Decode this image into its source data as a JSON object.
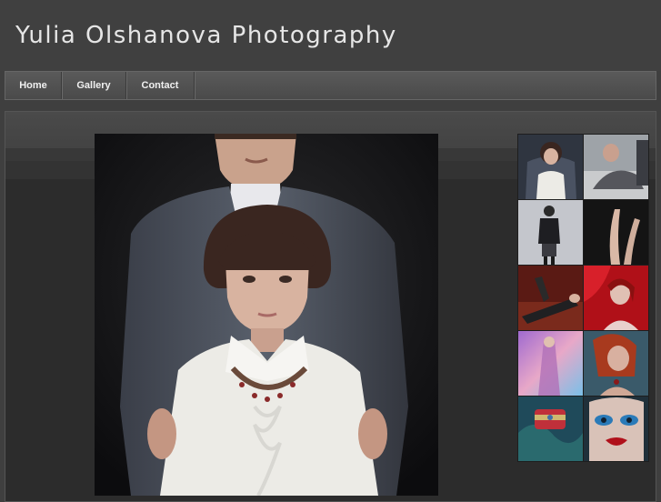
{
  "site": {
    "title": "Yulia Olshanova Photography"
  },
  "nav": {
    "items": [
      {
        "label": "Home"
      },
      {
        "label": "Gallery"
      },
      {
        "label": "Contact"
      }
    ]
  },
  "main_photo": {
    "subject": "portrait-woman-bob-haircut-man-behind"
  },
  "thumbnails": [
    {
      "subject": "couple-portrait"
    },
    {
      "subject": "woman-reclining"
    },
    {
      "subject": "woman-in-dress-standing"
    },
    {
      "subject": "legs-dark-background"
    },
    {
      "subject": "figure-on-red-floor"
    },
    {
      "subject": "woman-red-portrait"
    },
    {
      "subject": "colorful-painted-figure"
    },
    {
      "subject": "red-haired-woman"
    },
    {
      "subject": "jeweled-bracelet"
    },
    {
      "subject": "blue-makeup-face"
    }
  ],
  "colors": {
    "background": "#3f3f3f",
    "nav": "#505050",
    "content": "#2c2c2c",
    "title": "#e6e6e6"
  }
}
